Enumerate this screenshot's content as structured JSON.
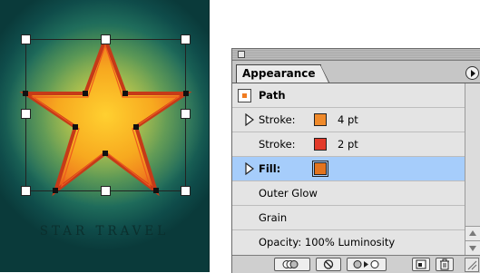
{
  "artwork": {
    "caption": "STAR TRAVEL",
    "colors": {
      "star_fill": "#f3a31e",
      "star_edge": "#d4431a",
      "background": "#0f4c4a"
    }
  },
  "panel": {
    "tab_label": "Appearance",
    "rows": [
      {
        "label": "Path"
      },
      {
        "label": "Stroke:",
        "weight": "4 pt",
        "color": "#f08a2a"
      },
      {
        "label": "Stroke:",
        "weight": "2 pt",
        "color": "#e23a2a"
      },
      {
        "label": "Fill:",
        "color": "#e3741e"
      },
      {
        "label": "Outer Glow"
      },
      {
        "label": "Grain"
      },
      {
        "label": "Opacity: 100% Luminosity"
      }
    ],
    "selected_row": "Fill:",
    "icons": {
      "close": "close-box-icon",
      "menu": "panel-menu-icon",
      "expand": "disclosure-triangle-icon",
      "toolbar": [
        "new-art-basic-appearance-icon",
        "clear-appearance-icon",
        "reduce-to-basic-appearance-icon",
        "duplicate-item-icon",
        "delete-item-icon"
      ]
    },
    "selection_color": "#a6cdfb"
  }
}
